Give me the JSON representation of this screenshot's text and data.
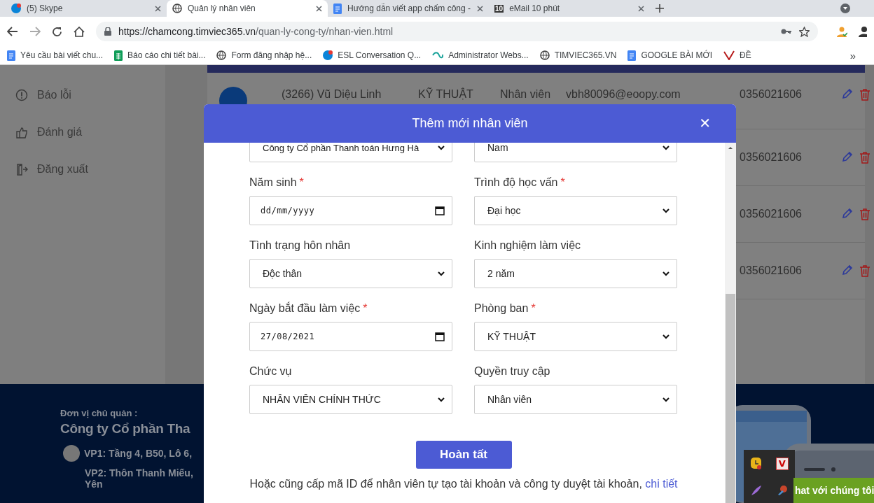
{
  "browser": {
    "tabs": [
      {
        "title": "(5) Skype",
        "kind": "chat",
        "selected": false
      },
      {
        "title": "Quản lý nhân viên",
        "kind": "globe",
        "selected": true
      },
      {
        "title": "Hướng dẫn viết app chấm công -",
        "kind": "doc",
        "selected": false
      },
      {
        "title": "eMail 10 phút",
        "kind": "badge",
        "icon_text": "10",
        "selected": false
      }
    ],
    "url_host": "https://chamcong.timviec365.vn",
    "url_path": "/quan-ly-cong-ty/nhan-vien.html",
    "bookmarks": [
      {
        "label": "Yêu cầu bài viết chu...",
        "kind": "doc"
      },
      {
        "label": "Báo cáo chi tiết bài...",
        "kind": "sheet"
      },
      {
        "label": "Form đăng nhập hệ...",
        "kind": "globe"
      },
      {
        "label": "ESL Conversation Q...",
        "kind": "chat"
      },
      {
        "label": "Administrator Webs...",
        "kind": "logo"
      },
      {
        "label": "TIMVIEC365.VN",
        "kind": "globe"
      },
      {
        "label": "GOOGLE BÀI MỚI",
        "kind": "doc"
      },
      {
        "label": "ĐỀ",
        "kind": "mark"
      }
    ],
    "more": "»"
  },
  "sidebar": {
    "items": [
      {
        "label": "Báo lỗi",
        "kind": "alert"
      },
      {
        "label": "Đánh giá",
        "kind": "thumb"
      },
      {
        "label": "Đăng xuất",
        "kind": "exit"
      }
    ]
  },
  "table": {
    "rows": [
      {
        "name": "(3266) Vũ Diệu Linh",
        "department": "KỸ THUẬT",
        "role": "Nhân viên",
        "email": "vbh80096@eoopy.com",
        "phone": "0356021606"
      },
      {
        "phone": "0356021606"
      },
      {
        "phone": "0356021606"
      },
      {
        "phone": "0356021606"
      }
    ]
  },
  "footer": {
    "owner_label": "Đơn vị chủ quản :",
    "company": "Công ty Cổ phần Tha",
    "offices": [
      "VP1: Tầng 4, B50, Lô 6,",
      "VP2: Thôn Thanh Miếu,",
      "Yên"
    ]
  },
  "modal": {
    "title": "Thêm mới nhân viên",
    "close": "✕",
    "fields": [
      {
        "kind": "select",
        "value": "Công ty Cổ phần Thanh toán Hưng Hà"
      },
      {
        "kind": "select",
        "value": "Nam"
      },
      {
        "label": "Năm sinh",
        "required_mark": "*",
        "kind": "date",
        "placeholder": "dd/mm/yyyy"
      },
      {
        "label": "Trình độ học vấn",
        "required_mark": "*",
        "kind": "select",
        "value": "Đại học"
      },
      {
        "label": "Tình trạng hôn nhân",
        "kind": "select",
        "value": "Độc thân"
      },
      {
        "label": "Kinh nghiệm làm việc",
        "kind": "select",
        "value": "2 năm"
      },
      {
        "label": "Ngày bắt đầu làm việc",
        "required_mark": "*",
        "kind": "date",
        "value": "27/08/2021"
      },
      {
        "label": "Phòng ban",
        "required_mark": "*",
        "kind": "select",
        "value": "KỸ THUẬT"
      },
      {
        "label": "Chức vụ",
        "kind": "select",
        "value": "NHÂN VIÊN CHÍNH THỨC"
      },
      {
        "label": "Quyền truy cập",
        "kind": "select",
        "value": "Nhân viên"
      }
    ],
    "submit": "Hoàn tất",
    "note": "Hoặc cũng cấp mã ID để nhân viên tự tạo tài khoản và công ty duyệt tài khoản,",
    "note_link": "chi tiết"
  },
  "tray": [
    {
      "kind": "clock"
    },
    {
      "kind": "letter",
      "text": "V"
    },
    {
      "kind": "feather"
    },
    {
      "kind": "brush"
    }
  ],
  "chat": {
    "label": "hat với chúng tôi"
  }
}
